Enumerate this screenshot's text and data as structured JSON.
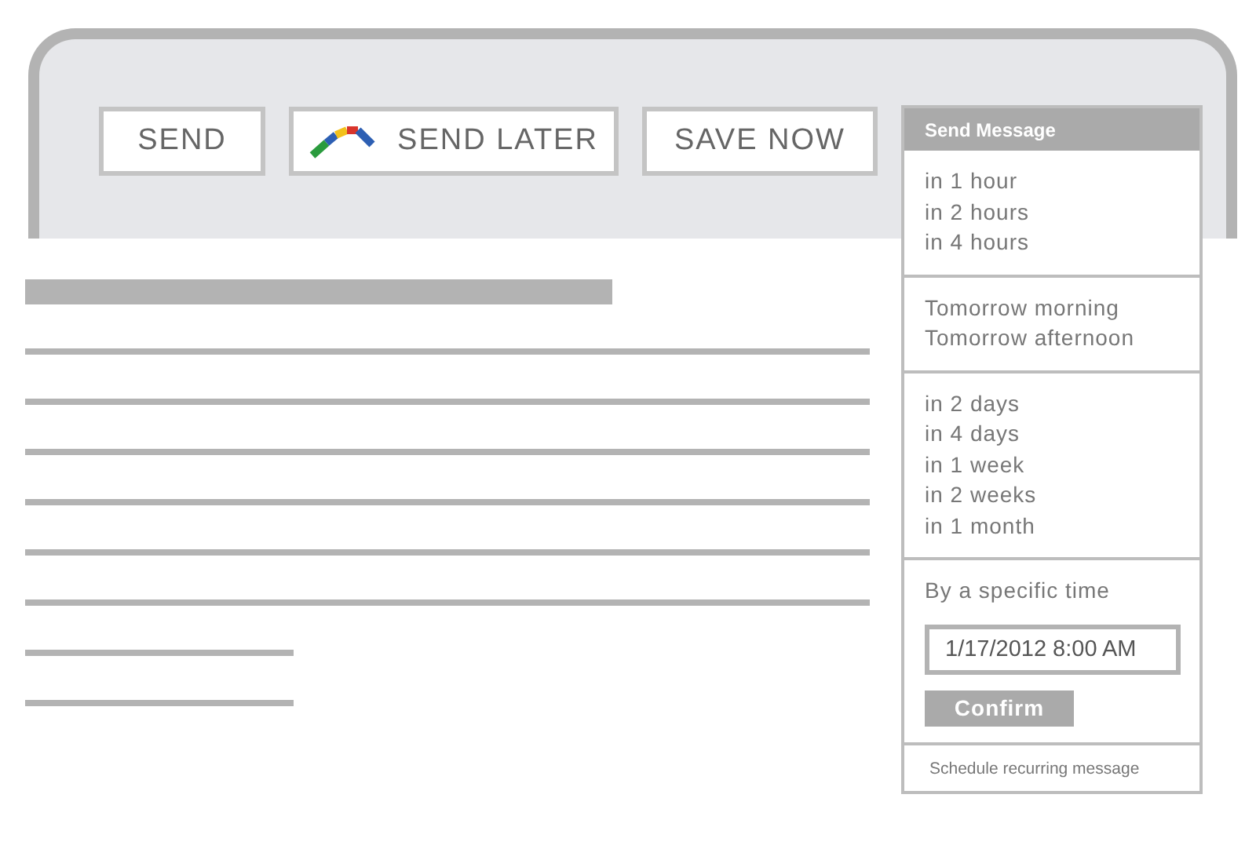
{
  "toolbar": {
    "buttons": [
      {
        "label": "SEND",
        "kind": "plain"
      },
      {
        "label": "SEND LATER",
        "kind": "logo"
      },
      {
        "label": "SAVE NOW",
        "kind": "plain"
      }
    ]
  },
  "send_menu": {
    "title": "Send Message",
    "groups": [
      [
        "in 1 hour",
        "in 2 hours",
        "in 4 hours"
      ],
      [
        "Tomorrow morning",
        "Tomorrow afternoon"
      ],
      [
        "in 2 days",
        "in 4 days",
        "in 1 week",
        "in 2 weeks",
        "in 1 month"
      ]
    ],
    "specific_time": {
      "label": "By a specific time",
      "value": "1/17/2012 8:00 AM",
      "confirm": "Confirm"
    },
    "footer_link": "Schedule recurring message"
  }
}
